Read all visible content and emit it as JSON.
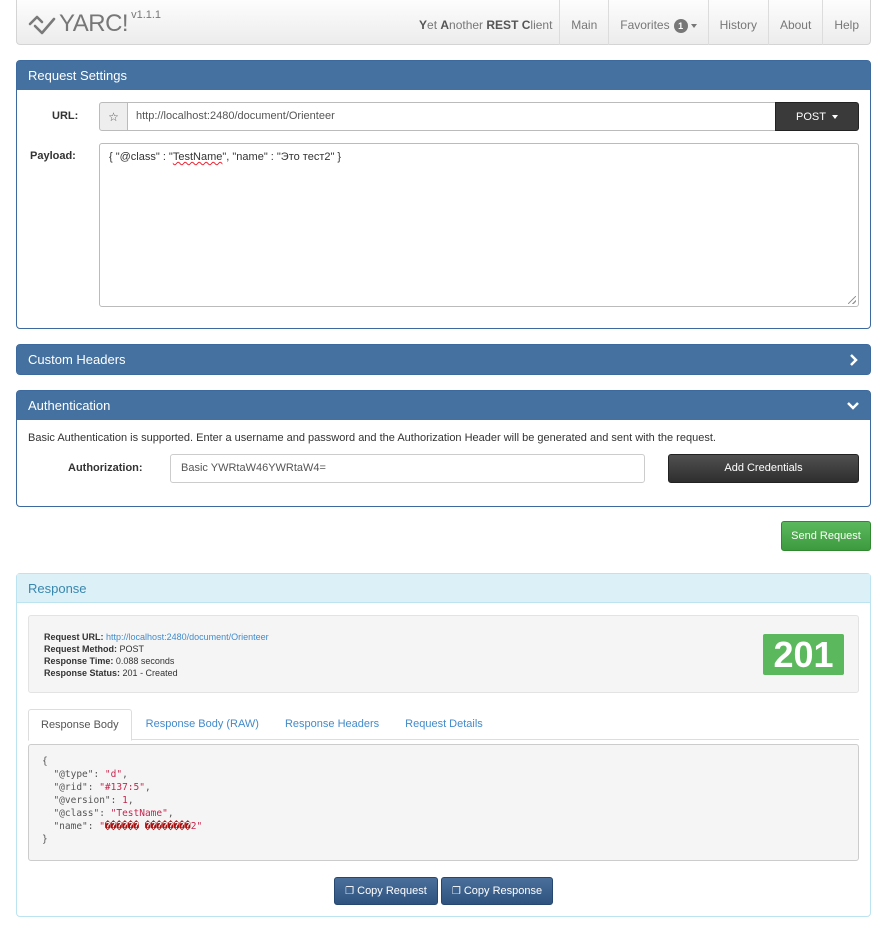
{
  "brand": {
    "name": "YARC!",
    "version": "v1.1.1"
  },
  "tagline": {
    "y": "Y",
    "et": "et ",
    "a": "A",
    "nother": "nother ",
    "rest": "REST",
    "c": "C",
    "lient": "lient"
  },
  "nav": {
    "main": "Main",
    "favorites": "Favorites",
    "favorites_count": "1",
    "history": "History",
    "about": "About",
    "help": "Help"
  },
  "request": {
    "title": "Request Settings",
    "url_label": "URL:",
    "url_value": "http://localhost:2480/document/Orienteer",
    "method": "POST",
    "payload_label": "Payload:",
    "payload_pre": "{ \"@class\" : \"",
    "payload_misspelled": "TestName",
    "payload_post": "\", \"name\" : \"Это тест2\" }"
  },
  "custom_headers": {
    "title": "Custom Headers"
  },
  "auth": {
    "title": "Authentication",
    "description": "Basic Authentication is supported. Enter a username and password and the Authorization Header will be generated and sent with the request.",
    "label": "Authorization:",
    "value": "Basic YWRtaW46YWRtaW4=",
    "add_button": "Add Credentials"
  },
  "send_button": "Send Request",
  "response": {
    "title": "Response",
    "url_label": "Request URL:",
    "url_value": "http://localhost:2480/document/Orienteer",
    "method_label": "Request Method:",
    "method_value": "POST",
    "time_label": "Response Time:",
    "time_value": "0.088 seconds",
    "status_label": "Response Status:",
    "status_value": "201 - Created",
    "status_code": "201",
    "tabs": [
      "Response Body",
      "Response Body (RAW)",
      "Response Headers",
      "Request Details"
    ],
    "body": {
      "open": "{",
      "l1_key": "  \"@type\": ",
      "l1_val": "\"d\"",
      "l1_end": ",",
      "l2_key": "  \"@rid\": ",
      "l2_val": "\"#137:5\"",
      "l2_end": ",",
      "l3_key": "  \"@version\": ",
      "l3_val": "1",
      "l3_end": ",",
      "l4_key": "  \"@class\": ",
      "l4_val": "\"TestName\"",
      "l4_end": ",",
      "l5_key": "  \"name\": ",
      "l5_q1": "\"",
      "l5_garbled": "������ ��������",
      "l5_tail": "2\"",
      "close": "}"
    },
    "copy_request": "Copy Request",
    "copy_response": "Copy Response"
  }
}
